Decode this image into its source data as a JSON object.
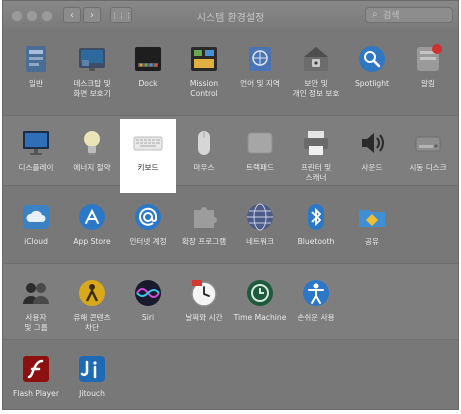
{
  "window": {
    "title": "시스템 환경설정",
    "search_placeholder": "검색",
    "back_label": "‹",
    "forward_label": "›",
    "grid_label": "⋮⋮⋮"
  },
  "rows": [
    [
      {
        "id": "general",
        "label": "일반",
        "icon": "general-icon"
      },
      {
        "id": "desktop",
        "label": "데스크탑 및\n화면 보호기",
        "icon": "desktop-icon"
      },
      {
        "id": "dock",
        "label": "Dock",
        "icon": "dock-icon"
      },
      {
        "id": "mission",
        "label": "Mission\nControl",
        "icon": "mission-control-icon"
      },
      {
        "id": "language",
        "label": "언어 및 지역",
        "icon": "flag-icon"
      },
      {
        "id": "security",
        "label": "보안 및\n개인 정보 보호",
        "icon": "house-lock-icon"
      },
      {
        "id": "spotlight",
        "label": "Spotlight",
        "icon": "spotlight-icon"
      },
      {
        "id": "notifications",
        "label": "알림",
        "icon": "notifications-icon"
      }
    ],
    [
      {
        "id": "displays",
        "label": "디스플레이",
        "icon": "display-icon"
      },
      {
        "id": "energy",
        "label": "에너지 절약",
        "icon": "lightbulb-icon"
      },
      {
        "id": "keyboard",
        "label": "키보드",
        "icon": "keyboard-icon",
        "selected": true
      },
      {
        "id": "mouse",
        "label": "마우스",
        "icon": "mouse-icon"
      },
      {
        "id": "trackpad",
        "label": "트랙패드",
        "icon": "trackpad-icon"
      },
      {
        "id": "printers",
        "label": "프린터 및\n스캐너",
        "icon": "printer-icon"
      },
      {
        "id": "sound",
        "label": "사운드",
        "icon": "speaker-icon"
      },
      {
        "id": "startup",
        "label": "시동 디스크",
        "icon": "disk-icon"
      }
    ],
    [
      {
        "id": "icloud",
        "label": "iCloud",
        "icon": "icloud-icon"
      },
      {
        "id": "appstore",
        "label": "App Store",
        "icon": "app-store-icon"
      },
      {
        "id": "internet",
        "label": "인터넷 계정",
        "icon": "at-sign-icon"
      },
      {
        "id": "extensions",
        "label": "확장 프로그램",
        "icon": "puzzle-icon"
      },
      {
        "id": "network",
        "label": "네트워크",
        "icon": "globe-icon"
      },
      {
        "id": "bluetooth",
        "label": "Bluetooth",
        "icon": "bluetooth-icon"
      },
      {
        "id": "sharing",
        "label": "공유",
        "icon": "shared-folder-icon"
      }
    ],
    [
      {
        "id": "users",
        "label": "사용자\n및 그룹",
        "icon": "users-icon"
      },
      {
        "id": "parental",
        "label": "유해 콘텐츠\n차단",
        "icon": "parental-controls-icon"
      },
      {
        "id": "siri",
        "label": "Siri",
        "icon": "siri-icon"
      },
      {
        "id": "datetime",
        "label": "날짜와 시간",
        "icon": "clock-icon"
      },
      {
        "id": "timemachine",
        "label": "Time Machine",
        "icon": "time-machine-icon"
      },
      {
        "id": "accessibility",
        "label": "손쉬운 사용",
        "icon": "accessibility-icon"
      }
    ],
    [
      {
        "id": "flash",
        "label": "Flash Player",
        "icon": "flash-icon"
      },
      {
        "id": "jitouch",
        "label": "Jitouch",
        "icon": "jitouch-icon"
      }
    ]
  ]
}
